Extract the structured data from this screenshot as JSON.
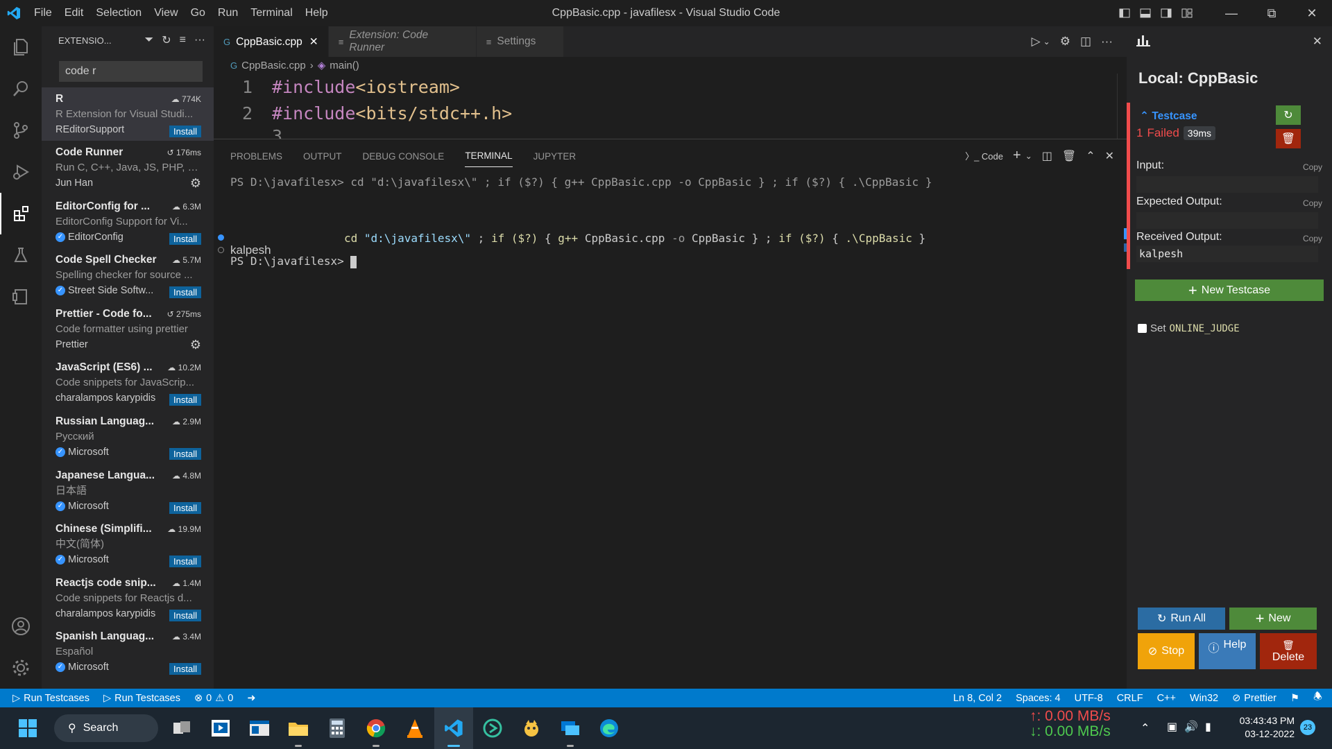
{
  "titlebar": {
    "menu": [
      "File",
      "Edit",
      "Selection",
      "View",
      "Go",
      "Run",
      "Terminal",
      "Help"
    ],
    "title": "CppBasic.cpp - javafilesx - Visual Studio Code"
  },
  "sidebar": {
    "title": "EXTENSIO...",
    "search_value": "code r",
    "extensions": [
      {
        "name": "R",
        "stat": "774K",
        "desc": "R Extension for Visual Studi...",
        "publisher": "REditorSupport",
        "verified": false,
        "action": "Install"
      },
      {
        "name": "Code Runner",
        "stat": "176ms",
        "desc": "Run C, C++, Java, JS, PHP, P...",
        "publisher": "Jun Han",
        "verified": false,
        "action": "gear"
      },
      {
        "name": "EditorConfig for ...",
        "stat": "6.3M",
        "desc": "EditorConfig Support for Vi...",
        "publisher": "EditorConfig",
        "verified": true,
        "action": "Install"
      },
      {
        "name": "Code Spell Checker",
        "stat": "5.7M",
        "desc": "Spelling checker for source ...",
        "publisher": "Street Side Softw...",
        "verified": true,
        "action": "Install"
      },
      {
        "name": "Prettier - Code fo...",
        "stat": "275ms",
        "desc": "Code formatter using prettier",
        "publisher": "Prettier",
        "verified": false,
        "action": "gear"
      },
      {
        "name": "JavaScript (ES6) ...",
        "stat": "10.2M",
        "desc": "Code snippets for JavaScrip...",
        "publisher": "charalampos karypidis",
        "verified": false,
        "action": "Install"
      },
      {
        "name": "Russian Languag...",
        "stat": "2.9M",
        "desc": "Русский",
        "publisher": "Microsoft",
        "verified": true,
        "action": "Install"
      },
      {
        "name": "Japanese Langua...",
        "stat": "4.8M",
        "desc": "日本語",
        "publisher": "Microsoft",
        "verified": true,
        "action": "Install"
      },
      {
        "name": "Chinese (Simplifi...",
        "stat": "19.9M",
        "desc": "中文(简体)",
        "publisher": "Microsoft",
        "verified": true,
        "action": "Install"
      },
      {
        "name": "Reactjs code snip...",
        "stat": "1.4M",
        "desc": "Code snippets for Reactjs d...",
        "publisher": "charalampos karypidis",
        "verified": false,
        "action": "Install"
      },
      {
        "name": "Spanish Languag...",
        "stat": "3.4M",
        "desc": "Español",
        "publisher": "Microsoft",
        "verified": true,
        "action": "Install"
      }
    ]
  },
  "editor": {
    "tabs": [
      {
        "label": "CppBasic.cpp",
        "active": true
      },
      {
        "label": "Extension: Code Runner",
        "active": false
      },
      {
        "label": "Settings",
        "active": false
      }
    ],
    "breadcrumb": [
      "CppBasic.cpp",
      "main()"
    ],
    "lines": [
      {
        "num": "1",
        "kw": "#include",
        "inc": "<iostream>"
      },
      {
        "num": "2",
        "kw": "#include",
        "inc": "<bits/stdc++.h>"
      }
    ]
  },
  "panel": {
    "tabs": [
      "PROBLEMS",
      "OUTPUT",
      "DEBUG CONSOLE",
      "TERMINAL",
      "JUPYTER"
    ],
    "active_tab": "TERMINAL",
    "terminal_label": "Code",
    "line1": "PS D:\\javafilesx> cd \"d:\\javafilesx\\\" ; if ($?) { g++ CppBasic.cpp -o CppBasic } ; if ($?) { .\\CppBasic }",
    "cmd_cd": "cd",
    "cmd_path": "\"d:\\javafilesx\\\"",
    "cmd_if1": "if",
    "cmd_q1": "($?)",
    "cmd_g": "g++",
    "cmd_file": "CppBasic.cpp",
    "cmd_o": "-o",
    "cmd_out": "CppBasic",
    "cmd_if2": "if",
    "cmd_q2": "($?)",
    "cmd_run": ".\\CppBasic",
    "output": "kalpesh",
    "prompt": "PS D:\\javafilesx>"
  },
  "cph": {
    "title": "Local: CppBasic",
    "testcase_label": "Testcase",
    "testcase_num": "1",
    "status": "Failed",
    "time": "39ms",
    "input_label": "Input:",
    "expected_label": "Expected Output:",
    "received_label": "Received Output:",
    "copy": "Copy",
    "received_value": "kalpesh",
    "new_testcase": "New Testcase",
    "set_label": "Set",
    "online_judge": "ONLINE_JUDGE",
    "run_all": "Run All",
    "new": "New",
    "stop": "Stop",
    "help": "Help",
    "delete": "Delete"
  },
  "status": {
    "left": [
      "Run Testcases",
      "Run Testcases"
    ],
    "errors": "0",
    "warnings": "0",
    "right": [
      "Ln 8, Col 2",
      "Spaces: 4",
      "UTF-8",
      "CRLF",
      "C++",
      "Win32",
      "Prettier"
    ]
  },
  "taskbar": {
    "search": "Search",
    "up": "↑: 0.00 MB/s",
    "down": "↓: 0.00 MB/s",
    "time": "03:43:43 PM",
    "date": "03-12-2022",
    "notif": "23"
  },
  "colors": {
    "accent": "#007acc",
    "failed": "#f14c4c",
    "green": "#4e8a3a",
    "orange": "#f0a30a",
    "red": "#a1260d"
  }
}
